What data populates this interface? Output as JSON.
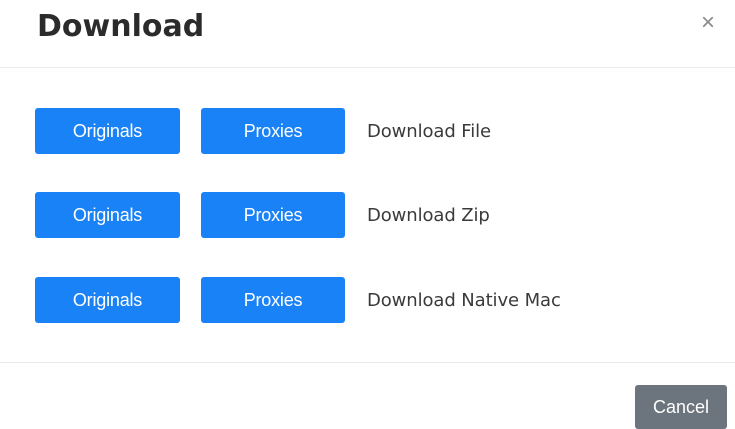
{
  "modal": {
    "title": "Download",
    "close_glyph": "×",
    "close_icon": "close-icon"
  },
  "rows": [
    {
      "originals_label": "Originals",
      "proxies_label": "Proxies",
      "label": "Download File"
    },
    {
      "originals_label": "Originals",
      "proxies_label": "Proxies",
      "label": "Download Zip"
    },
    {
      "originals_label": "Originals",
      "proxies_label": "Proxies",
      "label": "Download Native Mac"
    }
  ],
  "footer": {
    "cancel_label": "Cancel"
  },
  "colors": {
    "primary": "#1a82f7",
    "secondary": "#6c757d",
    "divider": "#e9ecef"
  }
}
